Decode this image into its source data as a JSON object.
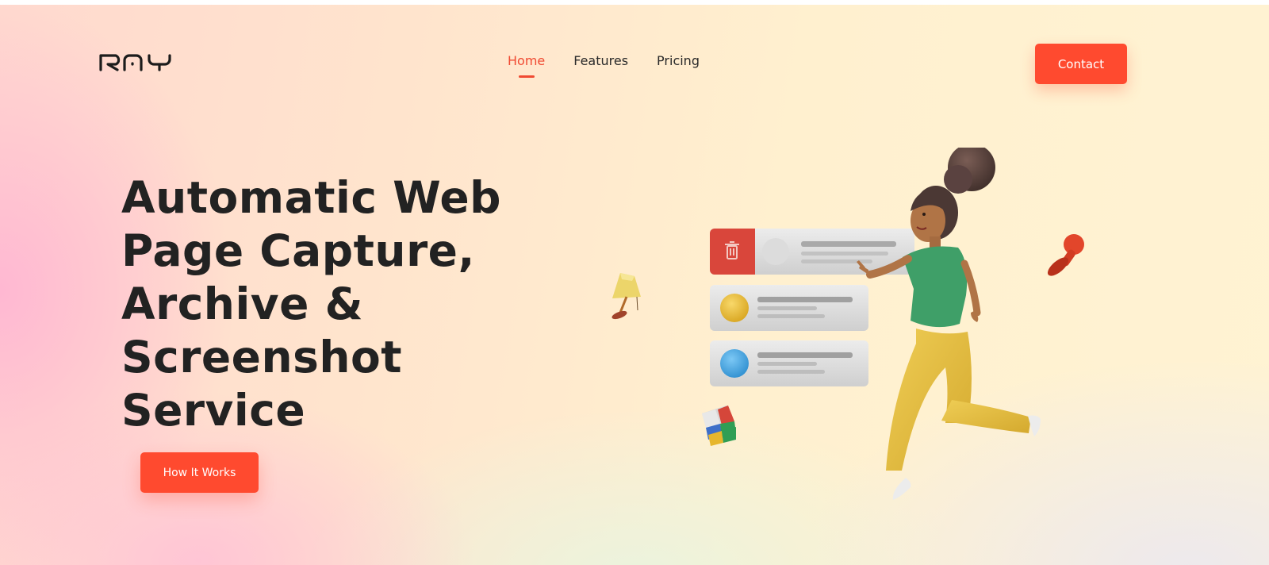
{
  "brand": {
    "logo_text": "RAY"
  },
  "nav": {
    "items": [
      {
        "label": "Home",
        "active": true
      },
      {
        "label": "Features",
        "active": false
      },
      {
        "label": "Pricing",
        "active": false
      }
    ],
    "contact_label": "Contact"
  },
  "hero": {
    "title_lines": [
      "Automatic Web",
      "Page Capture,",
      "Archive &",
      "Screenshot",
      "Service"
    ],
    "cta_label": "How It Works"
  },
  "colors": {
    "accent": "#ff4a2f",
    "nav_active": "#f04a32",
    "text_dark": "#222222"
  },
  "icons": [
    "trash-icon",
    "lamp-icon",
    "stamp-icon",
    "rubiks-cube-icon"
  ]
}
